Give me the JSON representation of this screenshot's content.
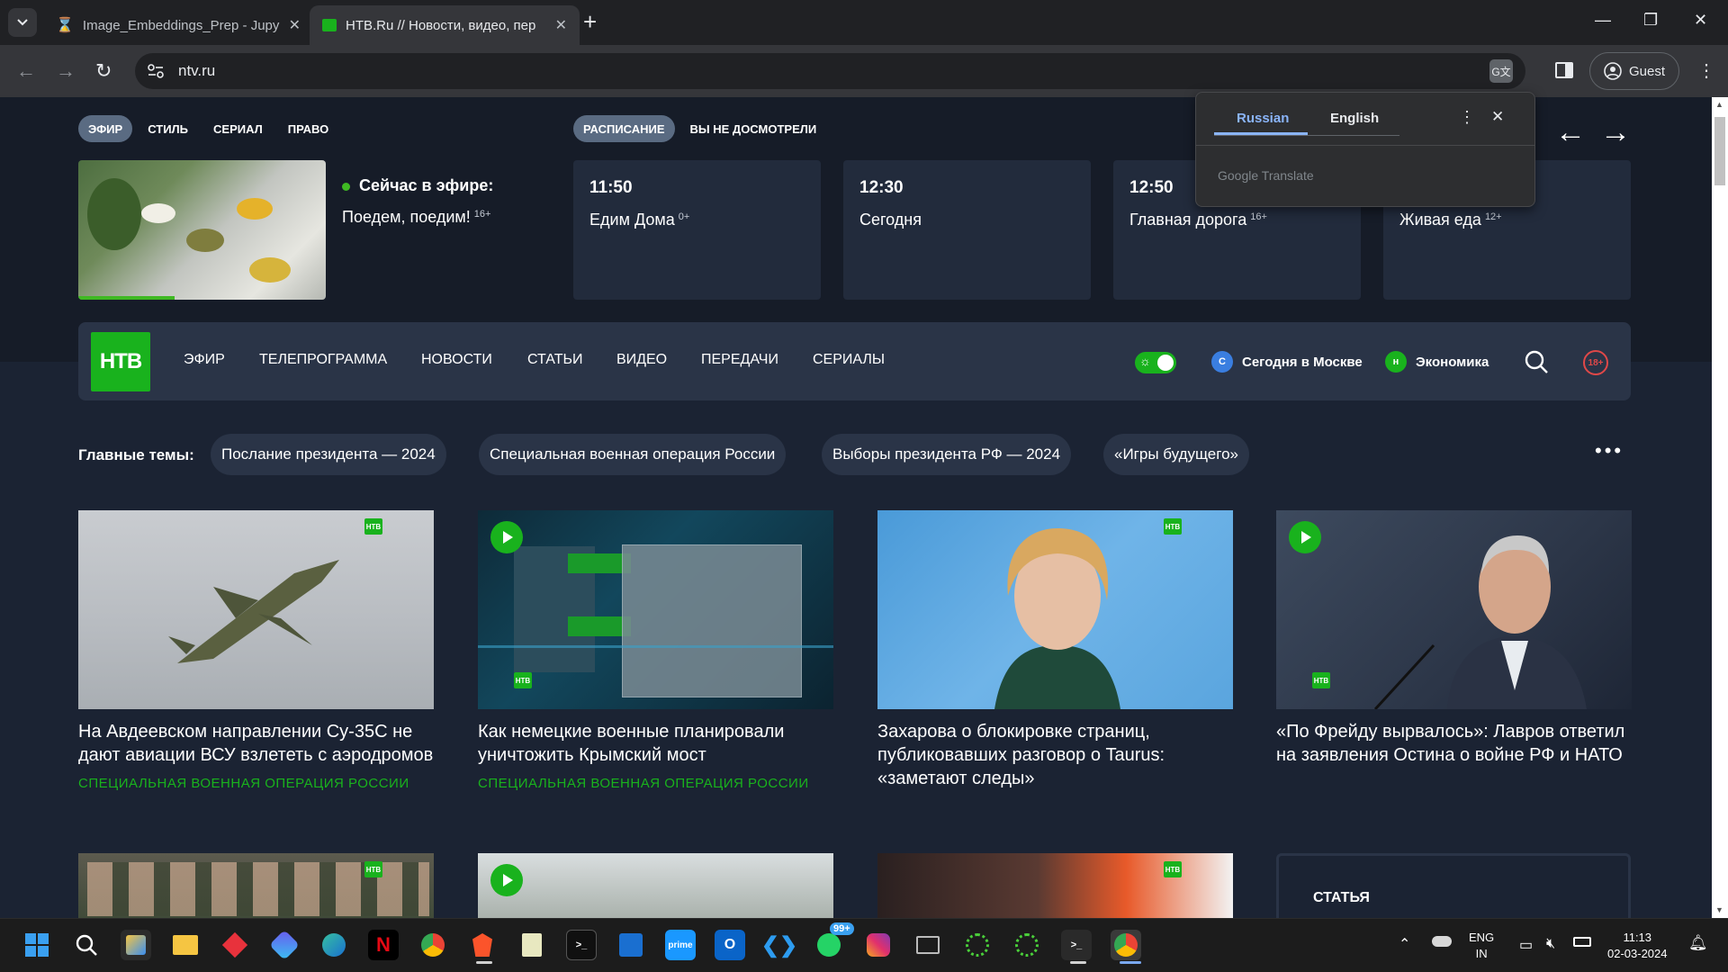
{
  "browser": {
    "tabs": [
      {
        "title": "Image_Embeddings_Prep - Jupy",
        "favicon": "hourglass-icon",
        "active": false
      },
      {
        "title": "НТВ.Ru // Новости, видео, пер",
        "favicon": "ntv-icon",
        "active": true
      }
    ],
    "url": "ntv.ru",
    "profile_label": "Guest"
  },
  "translate_popup": {
    "tab_source": "Russian",
    "tab_target": "English",
    "brand": "Google Translate"
  },
  "tv": {
    "pills_left": [
      "ЭФИР",
      "СТИЛЬ",
      "СЕРИАЛ",
      "ПРАВО"
    ],
    "pills_right": [
      "РАСПИСАНИЕ",
      "ВЫ НЕ ДОСМОТРЕЛИ"
    ],
    "live_label": "Сейчас в эфире:",
    "live_show": "Поедем, поедим!",
    "live_age": "16+",
    "live_progress": 0.39,
    "schedule": [
      {
        "time": "11:50",
        "title": "Едим Дома",
        "age": "0+"
      },
      {
        "time": "12:30",
        "title": "Сегодня",
        "age": ""
      },
      {
        "time": "12:50",
        "title": "Главная дорога",
        "age": "16+"
      },
      {
        "time": "",
        "title": "Живая еда",
        "age": "12+"
      }
    ]
  },
  "mainnav": {
    "logo": "НТВ",
    "items": [
      "ЭФИР",
      "ТЕЛЕПРОГРАММА",
      "НОВОСТИ",
      "СТАТЬИ",
      "ВИДЕО",
      "ПЕРЕДАЧИ",
      "СЕРИАЛЫ"
    ],
    "channel1": "Сегодня в Москве",
    "channel2": "Экономика",
    "age_badge": "18+"
  },
  "topics": {
    "label": "Главные темы:",
    "items": [
      "Послание президента — 2024",
      "Специальная военная операция России",
      "Выборы президента РФ — 2024",
      "«Игры будущего»"
    ]
  },
  "news": [
    {
      "title": "На Авдеевском направлении Су-35С не дают авиации ВСУ взлететь с аэродромов",
      "rubric": "СПЕЦИАЛЬНАЯ ВОЕННАЯ ОПЕРАЦИЯ РОССИИ"
    },
    {
      "title": "Как немецкие военные планировали уничтожить Крымский мост",
      "rubric": "СПЕЦИАЛЬНАЯ ВОЕННАЯ ОПЕРАЦИЯ РОССИИ"
    },
    {
      "title": "Захарова о блокировке страниц, публиковавших разговор о Taurus: «заметают следы»",
      "rubric": ""
    },
    {
      "title": "«По Фрейду вырвалось»: Лавров ответил на заявления Остина о войне РФ и НАТО",
      "rubric": ""
    }
  ],
  "article_box_label": "СТАТЬЯ",
  "taskbar": {
    "lang": "ENG",
    "region": "IN",
    "time": "11:13",
    "date": "02-03-2024",
    "badge": "99+"
  }
}
